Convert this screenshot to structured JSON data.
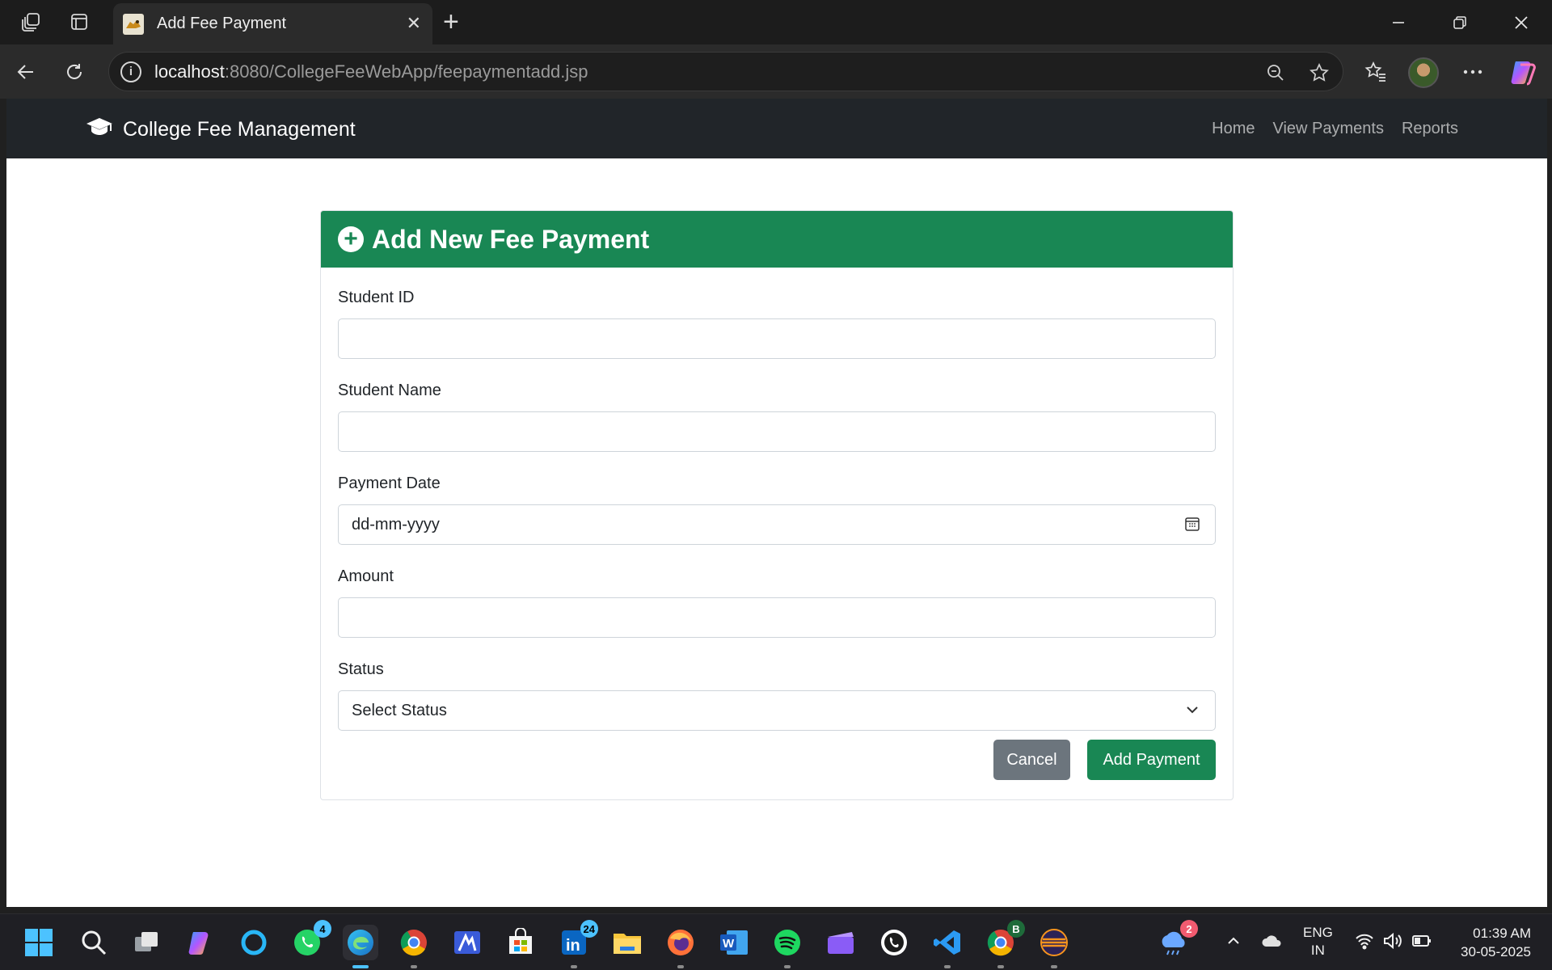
{
  "browser": {
    "tab_title": "Add Fee Payment",
    "url_host": "localhost",
    "url_path": ":8080/CollegeFeeWebApp/feepaymentadd.jsp"
  },
  "app": {
    "brand": "College Fee Management",
    "nav": [
      "Home",
      "View Payments",
      "Reports"
    ]
  },
  "form": {
    "title": "Add New Fee Payment",
    "fields": {
      "student_id": {
        "label": "Student ID",
        "value": ""
      },
      "student_name": {
        "label": "Student Name",
        "value": ""
      },
      "payment_date": {
        "label": "Payment Date",
        "placeholder": "dd-mm-yyyy"
      },
      "amount": {
        "label": "Amount",
        "value": ""
      },
      "status": {
        "label": "Status",
        "selected": "Select Status"
      }
    },
    "cancel_label": "Cancel",
    "submit_label": "Add Payment"
  },
  "taskbar": {
    "whatsapp_badge": "4",
    "linkedin_badge": "24",
    "chrome_badge": "B",
    "weather_badge": "2",
    "lang_top": "ENG",
    "lang_bottom": "IN",
    "time": "01:39 AM",
    "date": "30-05-2025"
  },
  "colors": {
    "primary_green": "#198754",
    "navbar_dark": "#212529",
    "cancel_gray": "#6c757d"
  }
}
